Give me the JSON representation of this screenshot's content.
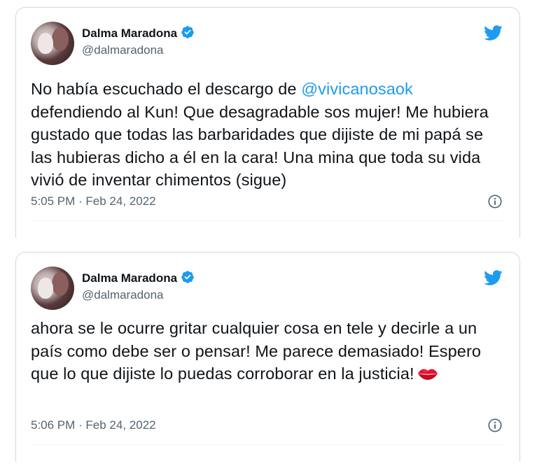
{
  "colors": {
    "accent": "#1d9bf0",
    "text": "#0f1419",
    "muted": "#536471",
    "border": "#cfd9de"
  },
  "tweets": [
    {
      "author_name": "Dalma Maradona",
      "handle": "@dalmaradona",
      "text_before_mention": "No había escuchado el descargo de ",
      "mention": "@vivicanosaok",
      "text_after_mention": " defendiendo al Kun! Que desagradable sos mujer! Me hubiera gustado que todas las barbaridades que dijiste de mi papá se las hubieras dicho a él en la cara! Una mina que toda su vida vivió de inventar chimentos (sigue)",
      "timestamp": "5:05 PM · Feb 24, 2022",
      "icons": [
        "avatar",
        "verified-badge-icon",
        "twitter-bird-icon",
        "info-icon"
      ]
    },
    {
      "author_name": "Dalma Maradona",
      "handle": "@dalmaradona",
      "text": "ahora se le ocurre gritar cualquier cosa en tele y decirle a un país como debe ser o pensar! Me parece demasiado! Espero que lo que dijiste lo puedas corroborar en la justicia!",
      "emoji": "kiss-mark-icon",
      "timestamp": "5:06 PM · Feb 24, 2022",
      "icons": [
        "avatar",
        "verified-badge-icon",
        "twitter-bird-icon",
        "info-icon"
      ]
    }
  ]
}
